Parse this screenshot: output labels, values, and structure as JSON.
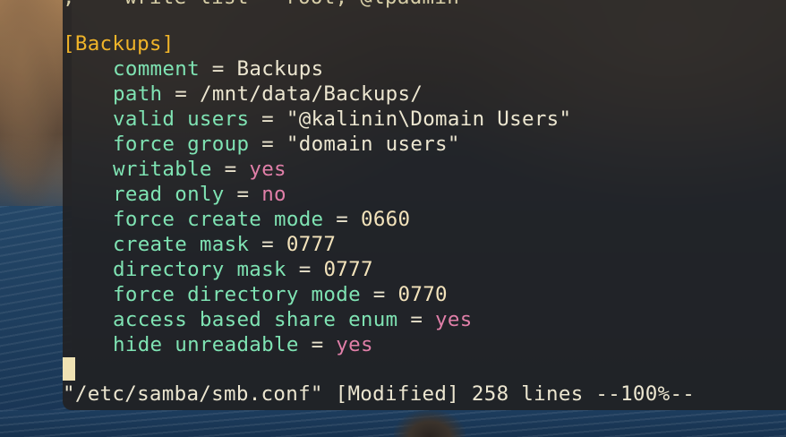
{
  "editor": {
    "top_partial_line": ";    write list = root, @lpadmin",
    "section_header": "[Backups]",
    "options": [
      {
        "key": "comment",
        "value": "Backups",
        "kind": "text"
      },
      {
        "key": "path",
        "value": "/mnt/data/Backups/",
        "kind": "text"
      },
      {
        "key": "valid users",
        "value": "\"@kalinin\\Domain Users\"",
        "kind": "text"
      },
      {
        "key": "force group",
        "value": "\"domain users\"",
        "kind": "text"
      },
      {
        "key": "writable",
        "value": "yes",
        "kind": "bool"
      },
      {
        "key": "read only",
        "value": "no",
        "kind": "bool"
      },
      {
        "key": "force create mode",
        "value": "0660",
        "kind": "num"
      },
      {
        "key": "create mask",
        "value": "0777",
        "kind": "num"
      },
      {
        "key": "directory mask",
        "value": "0777",
        "kind": "num"
      },
      {
        "key": "force directory mode",
        "value": "0770",
        "kind": "num"
      },
      {
        "key": "access based share enum",
        "value": "yes",
        "kind": "bool"
      },
      {
        "key": "hide unreadable",
        "value": "yes",
        "kind": "bool"
      }
    ],
    "equals": "=",
    "status_line": "\"/etc/samba/smb.conf\" [Modified] 258 lines --100%--"
  },
  "colors": {
    "section": "#f0b429",
    "key": "#7fe3b3",
    "bool": "#e07fa8",
    "number": "#f3e3bb",
    "text": "#ece6d0",
    "cursor": "#efe2b3"
  }
}
